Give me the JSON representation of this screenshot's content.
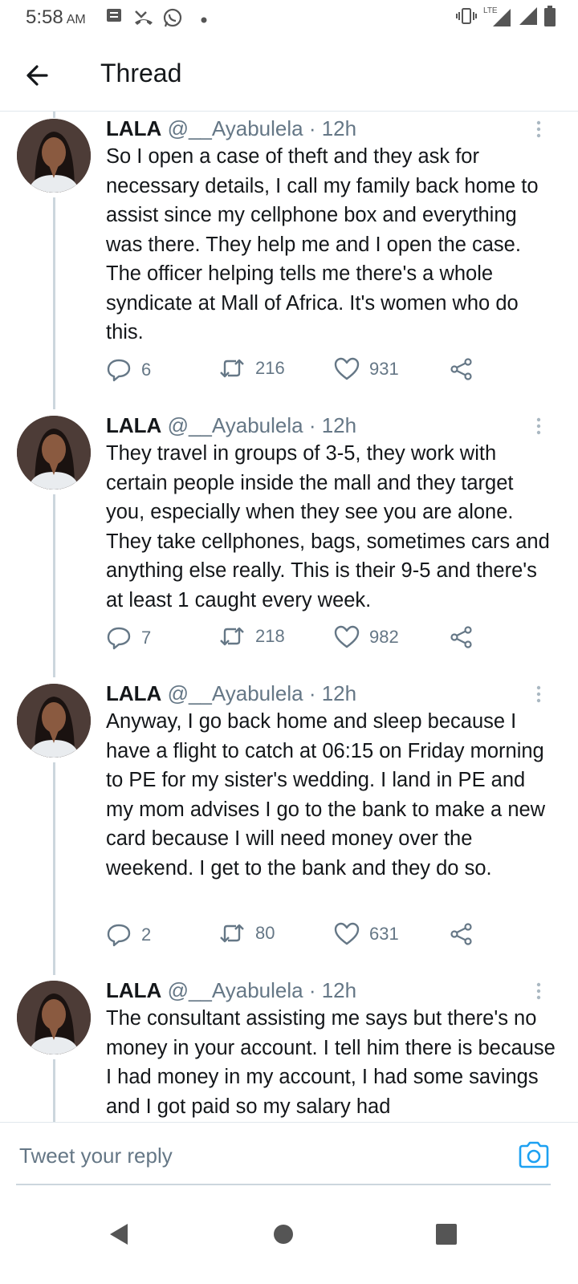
{
  "status_bar": {
    "time": "5:58",
    "ampm": "AM",
    "network": "LTE"
  },
  "header": {
    "title": "Thread"
  },
  "tweets": [
    {
      "name": "LALA",
      "handle": "@__Ayabulela · 12h",
      "text": "So I open a case of theft and they ask for necessary details, I call my family back home to assist since my cellphone box and everything was there. They help me and I open the case. The officer helping tells me there's a whole syndicate at Mall of Africa. It's women who do this.",
      "replies": "6",
      "retweets": "216",
      "likes": "931"
    },
    {
      "name": "LALA",
      "handle": "@__Ayabulela · 12h",
      "text": "They travel in groups of 3-5, they work with certain people inside the mall and they target you, especially when they see you are alone. They take cellphones, bags, sometimes cars and anything else really. This is their 9-5 and there's at least 1 caught every week.",
      "replies": "7",
      "retweets": "218",
      "likes": "982"
    },
    {
      "name": "LALA",
      "handle": "@__Ayabulela · 12h",
      "text": "Anyway, I go back home and sleep because I have a flight to catch at 06:15 on Friday morning to PE for my sister's wedding. I land in PE and my mom advises I go to the bank to make a new card because I will need money over the weekend. I get to the bank and they do so.",
      "replies": "2",
      "retweets": "80",
      "likes": "631"
    },
    {
      "name": "LALA",
      "handle": "@__Ayabulela · 12h",
      "text": "The consultant assisting me says but there's no money in your account. I tell him there is because I had money in my account, I had some savings and I got paid so my salary had"
    }
  ],
  "reply_bar": {
    "placeholder": "Tweet your reply"
  },
  "colors": {
    "accent": "#1da1f2",
    "text_primary": "#14171a",
    "text_secondary": "#657786",
    "divider": "#e1e8ed"
  },
  "icons": {
    "back": "arrow-left-icon",
    "reply": "speech-bubble-icon",
    "retweet": "retweet-icon",
    "like": "heart-icon",
    "share": "share-icon",
    "more": "vertical-dots-icon",
    "camera": "camera-icon"
  }
}
